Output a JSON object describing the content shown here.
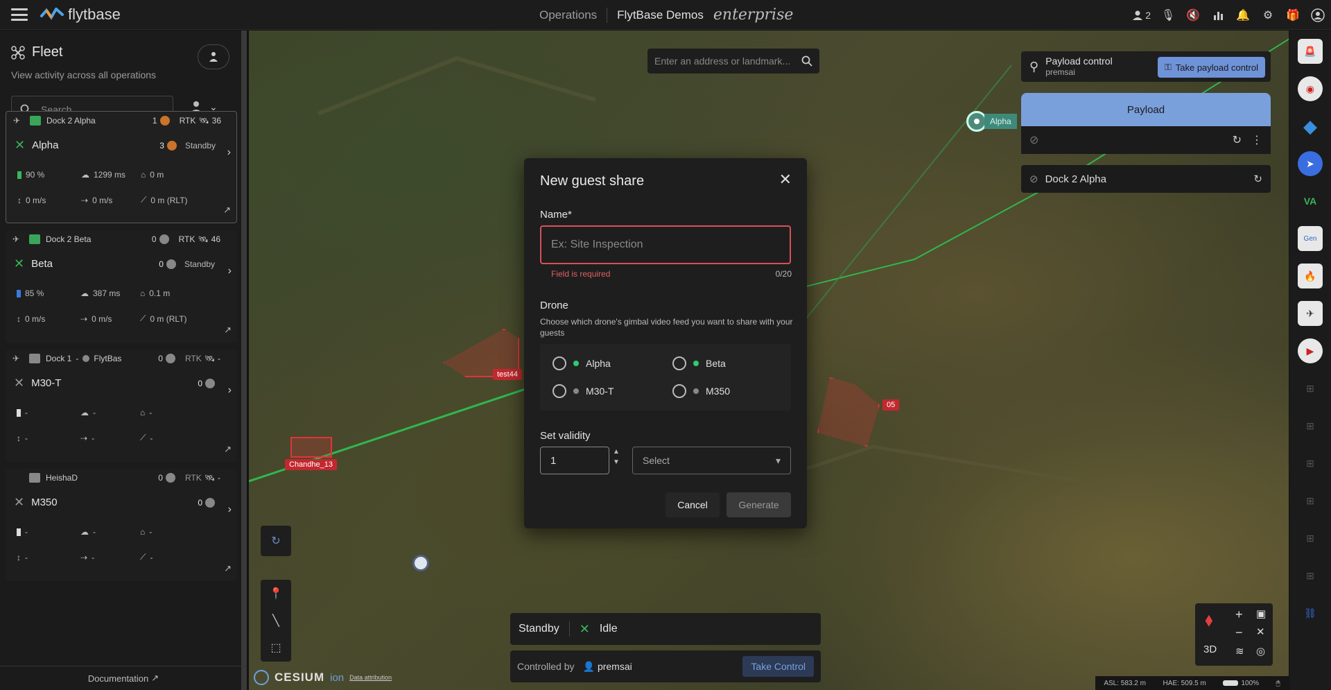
{
  "topbar": {
    "brand": "flytbase",
    "operations": "Operations",
    "org": "FlytBase Demos",
    "edition": "enterprise",
    "users_count": "2"
  },
  "sidebar": {
    "title": "Fleet",
    "subtitle": "View activity across all operations",
    "search_placeholder": "Search",
    "documentation": "Documentation",
    "cards": [
      {
        "dock": "Dock 2 Alpha",
        "dock_count": "1",
        "rtk": "RTK",
        "rtk_count": "36",
        "drone": "Alpha",
        "drone_count": "3",
        "state": "Standby",
        "battery": "90 %",
        "latency": "1299 ms",
        "home": "0 m",
        "vspeed": "0 m/s",
        "hspeed": "0 m/s",
        "alt": "0 m (RLT)"
      },
      {
        "dock": "Dock 2 Beta",
        "dock_count": "0",
        "rtk": "RTK",
        "rtk_count": "46",
        "drone": "Beta",
        "drone_count": "0",
        "state": "Standby",
        "battery": "85 %",
        "latency": "387 ms",
        "home": "0.1 m",
        "vspeed": "0 m/s",
        "hspeed": "0 m/s",
        "alt": "0 m (RLT)"
      },
      {
        "dock": "Dock 1",
        "dock_sep": "-",
        "dock_extra": "FlytBas",
        "dock_count": "0",
        "rtk": "RTK",
        "rtk_count": "-",
        "drone": "M30-T",
        "drone_count": "0",
        "state": "",
        "battery": "-",
        "latency": "-",
        "home": "-",
        "vspeed": "-",
        "hspeed": "-",
        "alt": "-"
      },
      {
        "dock": "HeishaD",
        "dock_count": "0",
        "rtk": "RTK",
        "rtk_count": "-",
        "drone": "M350",
        "drone_count": "0",
        "state": "",
        "battery": "-",
        "latency": "-",
        "home": "-",
        "vspeed": "-",
        "hspeed": "-",
        "alt": "-"
      }
    ]
  },
  "map": {
    "search_placeholder": "Enter an address or landmark...",
    "pin_label": "Alpha",
    "geofences": [
      "test44",
      "Chandhe_13",
      "05"
    ],
    "cesium": "CESIUM",
    "ion": "ion",
    "attribution": "Data attribution",
    "asl": "ASL: 583.2 m",
    "hae": "HAE: 509.5 m",
    "zoom": "100%",
    "view_mode": "3D"
  },
  "payload": {
    "control_title": "Payload control",
    "control_user": "premsai",
    "take_payload": "Take payload control",
    "tab": "Payload",
    "dock_name": "Dock 2 Alpha"
  },
  "status": {
    "mode": "Standby",
    "state": "Idle",
    "controlled_by": "Controlled by",
    "controller": "premsai",
    "take_control": "Take Control"
  },
  "modal": {
    "title": "New guest share",
    "name_label": "Name*",
    "name_placeholder": "Ex: Site Inspection",
    "name_error": "Field is required",
    "name_count": "0/20",
    "drone_label": "Drone",
    "drone_help": "Choose which drone's gimbal video feed you want to share with your guests",
    "drones": [
      {
        "name": "Alpha",
        "online": true
      },
      {
        "name": "Beta",
        "online": true
      },
      {
        "name": "M30-T",
        "online": false
      },
      {
        "name": "M350",
        "online": false
      }
    ],
    "validity_label": "Set validity",
    "validity_value": "1",
    "validity_unit_placeholder": "Select",
    "cancel": "Cancel",
    "generate": "Generate"
  },
  "colors": {
    "accent_blue": "#7aa0dc",
    "online_green": "#2ecc71",
    "error_red": "#d8505a",
    "geofence_red": "#e0343a"
  }
}
